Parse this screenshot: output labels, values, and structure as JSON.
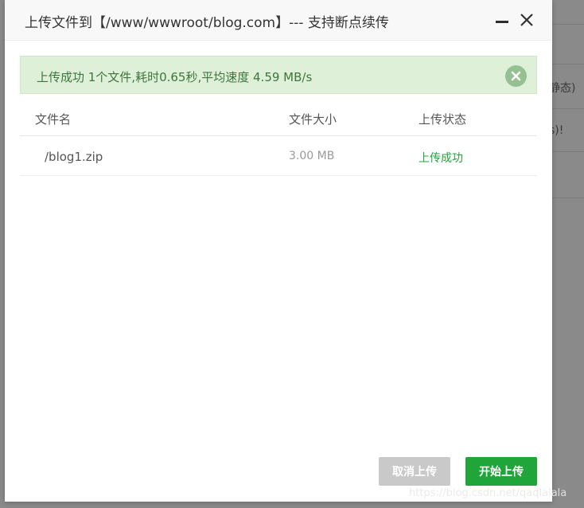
{
  "background": {
    "text_1": "静态)",
    "text_2": "s)!"
  },
  "dialog": {
    "title": "上传文件到【/www/wwwroot/blog.com】--- 支持断点续传",
    "minimize_icon": "minimize-icon",
    "close_icon": "close-icon"
  },
  "alert": {
    "message": "上传成功 1个文件,耗时0.65秒,平均速度 4.59 MB/s",
    "close_icon": "close-circle-icon",
    "color": "#3c763d",
    "background": "#dff0d8"
  },
  "table": {
    "headers": {
      "name": "文件名",
      "size": "文件大小",
      "status": "上传状态"
    },
    "rows": [
      {
        "name": "/blog1.zip",
        "size": "3.00 MB",
        "status": "上传成功"
      }
    ]
  },
  "footer": {
    "cancel_label": "取消上传",
    "start_label": "开始上传"
  },
  "colors": {
    "accent": "#20a53a",
    "disabled": "#c9c9c9"
  },
  "watermark": "https://blog.csdn.net/qaqlalala"
}
